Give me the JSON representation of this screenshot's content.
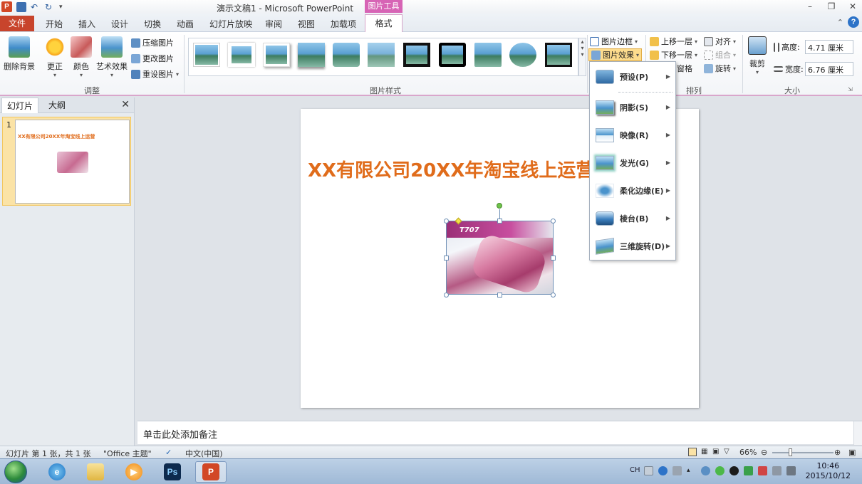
{
  "window": {
    "title": "演示文稿1 - Microsoft PowerPoint",
    "context_tools": "图片工具"
  },
  "tabs": {
    "file": "文件",
    "items": [
      "开始",
      "插入",
      "设计",
      "切换",
      "动画",
      "幻灯片放映",
      "审阅",
      "视图",
      "加载项"
    ],
    "active": "格式"
  },
  "ribbon": {
    "adjust": {
      "remove_bg": "删除背景",
      "corrections": "更正",
      "color": "颜色",
      "artistic": "艺术效果",
      "compress": "压缩图片",
      "change": "更改图片",
      "reset": "重设图片",
      "label": "调整"
    },
    "styles": {
      "label": "图片样式"
    },
    "picture_border": "图片边框",
    "picture_effects": "图片效果",
    "arrange": {
      "bring_forward": "上移一层",
      "send_backward": "下移一层",
      "selection_pane": "窗格",
      "align": "对齐",
      "group": "组合",
      "rotate": "旋转",
      "label": "排列"
    },
    "size": {
      "crop": "裁剪",
      "height_label": "高度:",
      "height_value": "4.71 厘米",
      "width_label": "宽度:",
      "width_value": "6.76 厘米",
      "label": "大小"
    }
  },
  "left_pane": {
    "tab_slides": "幻灯片",
    "tab_outline": "大纲",
    "slide_number": "1",
    "thumb_title": "XX有限公司20XX年淘宝线上运营"
  },
  "slide": {
    "title": "XX有限公司20XX年淘宝线上运营",
    "photo_label": "T707"
  },
  "notes": {
    "placeholder": "单击此处添加备注"
  },
  "status": {
    "slide_info": "幻灯片 第 1 张，共 1 张",
    "theme": "\"Office 主题\"",
    "language": "中文(中国)",
    "zoom": "66%"
  },
  "dropdown": {
    "items": [
      "预设(P)",
      "阴影(S)",
      "映像(R)",
      "发光(G)",
      "柔化边缘(E)",
      "棱台(B)",
      "三维旋转(D)"
    ]
  },
  "taskbar": {
    "ime": "CH",
    "time": "10:46",
    "date": "2015/10/12",
    "ps_label": "Ps",
    "ppt_label": "P"
  },
  "colors": {
    "accent_orange": "#e06c1b",
    "context_pink": "#d764b5",
    "file_tab": "#c8442c"
  }
}
